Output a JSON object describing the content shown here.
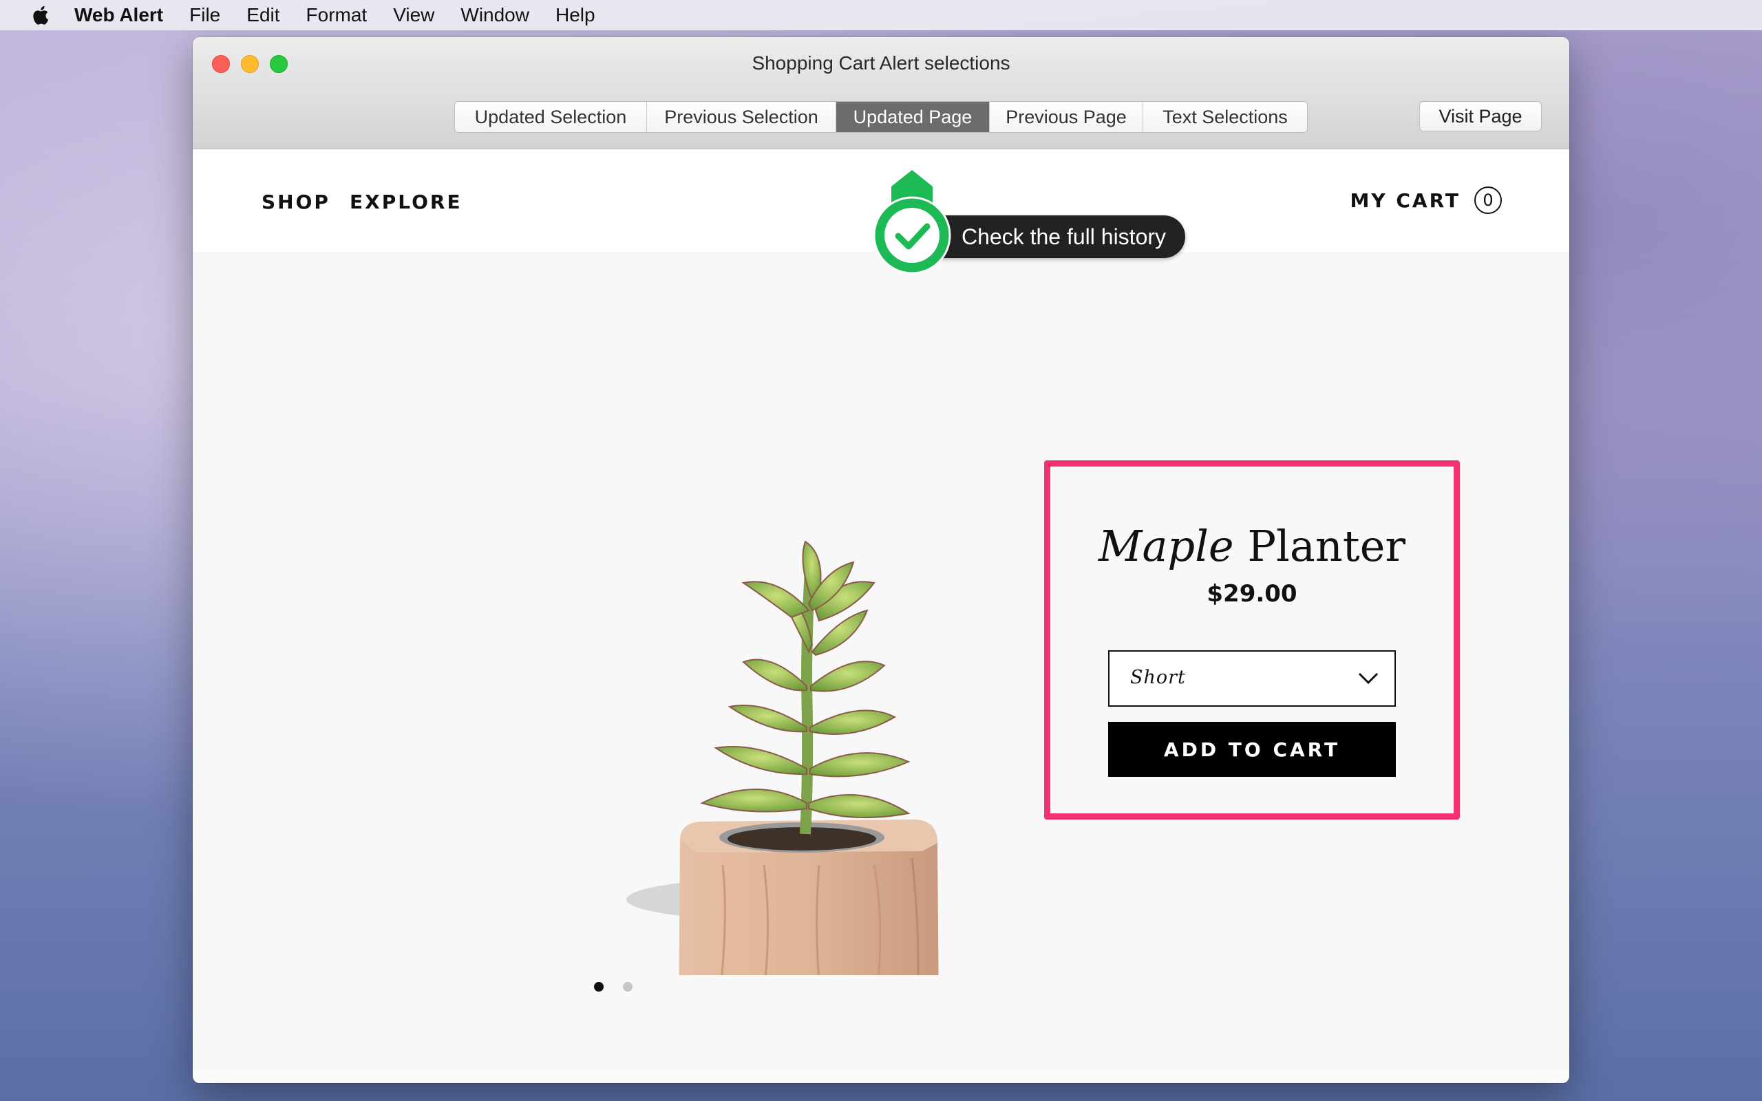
{
  "menubar": {
    "app_name": "Web Alert",
    "items": [
      "File",
      "Edit",
      "Format",
      "View",
      "Window",
      "Help"
    ]
  },
  "window": {
    "title": "Shopping Cart Alert selections",
    "tabs": [
      {
        "label": "Updated Selection",
        "active": false
      },
      {
        "label": "Previous Selection",
        "active": false
      },
      {
        "label": "Updated Page",
        "active": true
      },
      {
        "label": "Previous Page",
        "active": false
      },
      {
        "label": "Text Selections",
        "active": false
      }
    ],
    "visit_button": "Visit Page"
  },
  "site": {
    "nav": [
      "SHOP",
      "EXPLORE"
    ],
    "cart_label": "MY CART",
    "cart_count": "0"
  },
  "tooltip": {
    "text": "Check the full history",
    "icon": "checkmark-badge-icon",
    "color": "#1db954"
  },
  "product": {
    "title_italic": "Maple",
    "title_rest": "Planter",
    "price": "$29.00",
    "size_selected": "Short",
    "add_to_cart": "ADD TO CART",
    "image": "succulent-in-wood-planter",
    "carousel_count": 2,
    "carousel_active": 1
  },
  "colors": {
    "highlight": "#f4316f",
    "active_tab": "#6c6c6c"
  }
}
